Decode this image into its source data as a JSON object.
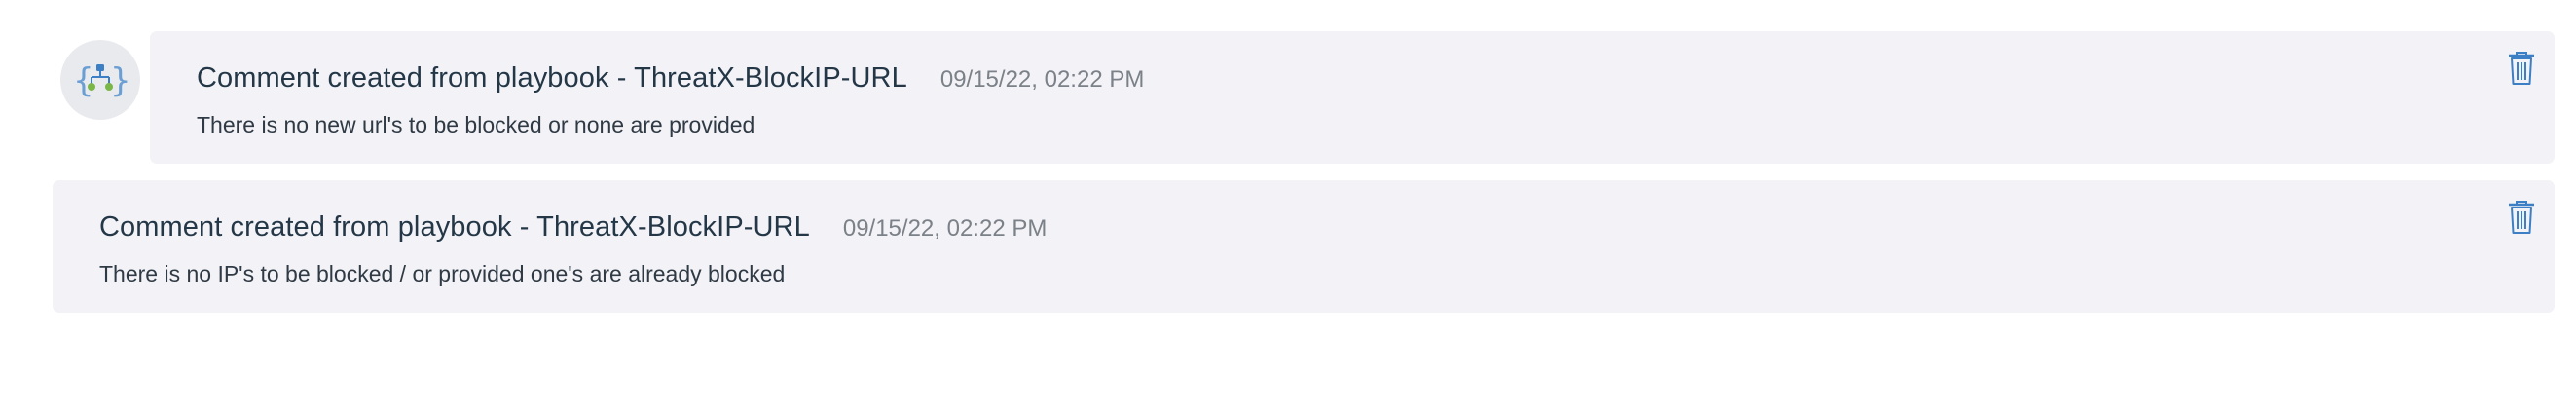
{
  "comments": [
    {
      "has_avatar": true,
      "avatar_icon": "playbook-icon",
      "title": "Comment created from playbook - ThreatX-BlockIP-URL",
      "timestamp": "09/15/22, 02:22 PM",
      "body": "There is no new url's to be blocked or none are provided",
      "delete_icon": "trash-icon"
    },
    {
      "has_avatar": false,
      "title": "Comment created from playbook - ThreatX-BlockIP-URL",
      "timestamp": "09/15/22, 02:22 PM",
      "body": "There is no IP's to be blocked / or provided one's are already blocked",
      "delete_icon": "trash-icon"
    }
  ],
  "colors": {
    "card_background": "#f3f2f7",
    "title": "#243747",
    "timestamp": "#7b8188",
    "body_text": "#2f3a44",
    "trash_icon": "#3d7fc4",
    "avatar_background": "#e9eaee",
    "avatar_braces": "#6b9fd4",
    "avatar_nodes": "#7ab648"
  }
}
